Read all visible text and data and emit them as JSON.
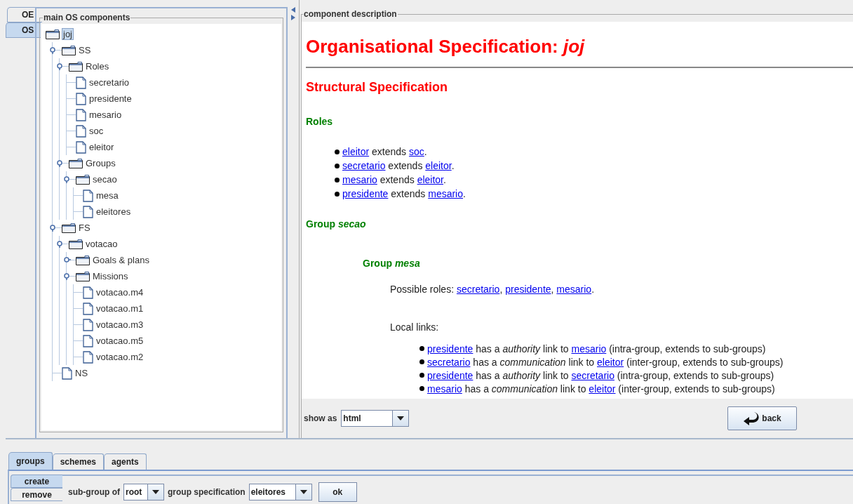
{
  "side_tabs": [
    {
      "label": "OE",
      "selected": false
    },
    {
      "label": "OS",
      "selected": true
    }
  ],
  "tree_panel": {
    "title": "main OS components",
    "tree": [
      {
        "label": "joj",
        "kind": "folder",
        "selected": true,
        "children": [
          {
            "label": "SS",
            "kind": "folder",
            "expanded": true,
            "selected": false,
            "children": [
              {
                "label": "Roles",
                "kind": "folder",
                "expanded": true,
                "selected": false,
                "children": [
                  {
                    "label": "secretario",
                    "kind": "file",
                    "selected": false
                  },
                  {
                    "label": "presidente",
                    "kind": "file",
                    "selected": false
                  },
                  {
                    "label": "mesario",
                    "kind": "file",
                    "selected": false
                  },
                  {
                    "label": "soc",
                    "kind": "file",
                    "selected": false
                  },
                  {
                    "label": "eleitor",
                    "kind": "file",
                    "selected": false
                  }
                ]
              },
              {
                "label": "Groups",
                "kind": "folder",
                "expanded": true,
                "selected": false,
                "children": [
                  {
                    "label": "secao",
                    "kind": "folder",
                    "expanded": true,
                    "selected": false,
                    "children": [
                      {
                        "label": "mesa",
                        "kind": "file",
                        "selected": false
                      },
                      {
                        "label": "eleitores",
                        "kind": "file",
                        "selected": false
                      }
                    ]
                  }
                ]
              }
            ]
          },
          {
            "label": "FS",
            "kind": "folder",
            "expanded": true,
            "selected": false,
            "children": [
              {
                "label": "votacao",
                "kind": "folder",
                "expanded": true,
                "selected": false,
                "children": [
                  {
                    "label": "Goals & plans",
                    "kind": "folder",
                    "expanded": false,
                    "selected": false
                  },
                  {
                    "label": "Missions",
                    "kind": "folder",
                    "expanded": true,
                    "selected": false,
                    "children": [
                      {
                        "label": "votacao.m4",
                        "kind": "file",
                        "selected": false
                      },
                      {
                        "label": "votacao.m1",
                        "kind": "file",
                        "selected": false
                      },
                      {
                        "label": "votacao.m3",
                        "kind": "file",
                        "selected": false
                      },
                      {
                        "label": "votacao.m5",
                        "kind": "file",
                        "selected": false
                      },
                      {
                        "label": "votacao.m2",
                        "kind": "file",
                        "selected": false
                      }
                    ]
                  }
                ]
              }
            ]
          },
          {
            "label": "NS",
            "kind": "file",
            "selected": false
          }
        ]
      }
    ]
  },
  "description_panel": {
    "title": "component description",
    "document": [
      {
        "kind": "title",
        "text": "Organisational Specification: *joj*"
      },
      {
        "kind": "rule"
      },
      {
        "kind": "section",
        "text": "Structural Specification"
      },
      {
        "kind": "subsection",
        "text": "Roles"
      },
      {
        "kind": "role_list",
        "items": [
          [
            {
              "kind": "link",
              "text": "eleitor"
            },
            {
              "kind": "text",
              "text": " extends "
            },
            {
              "kind": "link",
              "text": "soc"
            },
            {
              "kind": "text",
              "text": "."
            }
          ],
          [
            {
              "kind": "link",
              "text": "secretario"
            },
            {
              "kind": "text",
              "text": " extends "
            },
            {
              "kind": "link",
              "text": "eleitor"
            },
            {
              "kind": "text",
              "text": "."
            }
          ],
          [
            {
              "kind": "link",
              "text": "mesario"
            },
            {
              "kind": "text",
              "text": " extends "
            },
            {
              "kind": "link",
              "text": "eleitor"
            },
            {
              "kind": "text",
              "text": "."
            }
          ],
          [
            {
              "kind": "link",
              "text": "presidente"
            },
            {
              "kind": "text",
              "text": " extends "
            },
            {
              "kind": "link",
              "text": "mesario"
            },
            {
              "kind": "text",
              "text": "."
            }
          ]
        ]
      },
      {
        "kind": "subsection",
        "text": "Group *secao*"
      },
      {
        "kind": "group_heading",
        "text": "Group *mesa*"
      },
      {
        "kind": "paragraph",
        "parts": [
          {
            "kind": "text",
            "text": "Possible roles: "
          },
          {
            "kind": "link",
            "text": "secretario"
          },
          {
            "kind": "text",
            "text": ", "
          },
          {
            "kind": "link",
            "text": "presidente"
          },
          {
            "kind": "text",
            "text": ", "
          },
          {
            "kind": "link",
            "text": "mesario"
          },
          {
            "kind": "text",
            "text": "."
          }
        ]
      },
      {
        "kind": "paragraph_label",
        "text": "Local links:"
      },
      {
        "kind": "link_list",
        "items": [
          [
            {
              "kind": "link",
              "text": "presidente"
            },
            {
              "kind": "text",
              "text": " has a *authority* link to "
            },
            {
              "kind": "link",
              "text": "mesario"
            },
            {
              "kind": "text",
              "text": " (intra-group, extends to sub-groups)"
            }
          ],
          [
            {
              "kind": "link",
              "text": "secretario"
            },
            {
              "kind": "text",
              "text": " has a *communication* link to "
            },
            {
              "kind": "link",
              "text": "eleitor"
            },
            {
              "kind": "text",
              "text": " (inter-group, extends to sub-groups)"
            }
          ],
          [
            {
              "kind": "link",
              "text": "presidente"
            },
            {
              "kind": "text",
              "text": " has a *authority* link to "
            },
            {
              "kind": "link",
              "text": "secretario"
            },
            {
              "kind": "text",
              "text": " (intra-group, extends to sub-groups)"
            }
          ],
          [
            {
              "kind": "link",
              "text": "mesario"
            },
            {
              "kind": "text",
              "text": " has a *communication* link to "
            },
            {
              "kind": "link",
              "text": "eleitor"
            },
            {
              "kind": "text",
              "text": " (inter-group, extends to sub-groups)"
            }
          ]
        ]
      }
    ],
    "show_as": {
      "label": "show as",
      "value": "html"
    },
    "back_button": "back"
  },
  "bottom_tabs": [
    {
      "label": "groups",
      "selected": true
    },
    {
      "label": "schemes",
      "selected": false
    },
    {
      "label": "agents",
      "selected": false
    }
  ],
  "group_actions": [
    {
      "label": "create",
      "selected": true
    },
    {
      "label": "remove",
      "selected": false
    }
  ],
  "form": {
    "subgroup_label": "sub-group of",
    "subgroup_value": "root",
    "spec_label": "group specification",
    "spec_value": "eleitores",
    "ok_button": "ok"
  }
}
